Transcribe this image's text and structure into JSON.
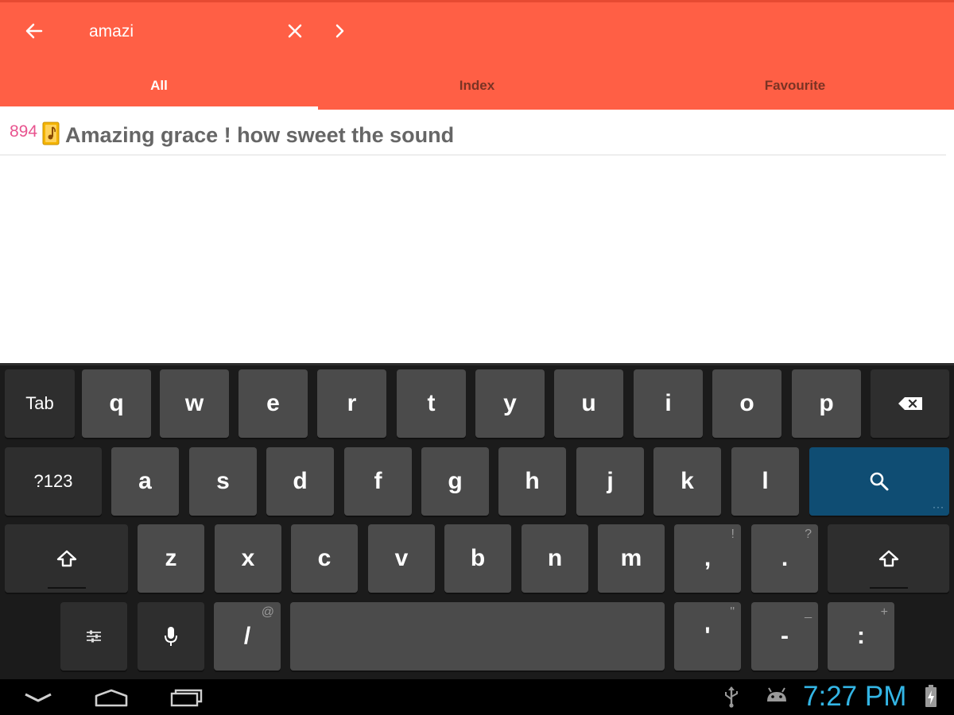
{
  "colors": {
    "appbar": "#FF5F45",
    "accent_number": "#E8548F",
    "clock": "#33B5E5",
    "search_key": "#0F4D73"
  },
  "search": {
    "value": "amazi"
  },
  "tabs": [
    {
      "label": "All",
      "active": true
    },
    {
      "label": "Index",
      "active": false
    },
    {
      "label": "Favourite",
      "active": false
    }
  ],
  "results": [
    {
      "number": "894",
      "title": "Amazing grace ! how sweet the sound",
      "icon": "music-sheet-icon"
    }
  ],
  "keyboard": {
    "row1": {
      "tab": "Tab",
      "keys": [
        "q",
        "w",
        "e",
        "r",
        "t",
        "y",
        "u",
        "i",
        "o",
        "p"
      ],
      "backspace_icon": "backspace-icon"
    },
    "row2": {
      "symbols": "?123",
      "keys": [
        "a",
        "s",
        "d",
        "f",
        "g",
        "h",
        "j",
        "k",
        "l"
      ],
      "search_icon": "search-icon"
    },
    "row3": {
      "shift_icon": "shift-icon",
      "keys": [
        "z",
        "x",
        "c",
        "v",
        "b",
        "n",
        "m"
      ],
      "comma": ",",
      "comma_hint": "!",
      "period": ".",
      "period_hint": "?"
    },
    "row4": {
      "settings_icon": "settings-sliders-icon",
      "mic_icon": "microphone-icon",
      "slash": "/",
      "slash_hint": "@",
      "apostrophe": "'",
      "apostrophe_hint": "\"",
      "dash": "-",
      "dash_hint": "_",
      "colon": ":",
      "colon_hint": "+"
    }
  },
  "navbar": {
    "back_icon": "nav-back-icon",
    "home_icon": "nav-home-icon",
    "recents_icon": "nav-recents-icon",
    "usb_icon": "usb-icon",
    "android_icon": "android-debug-icon",
    "time": "7:27 PM",
    "battery_icon": "battery-charging-icon"
  }
}
